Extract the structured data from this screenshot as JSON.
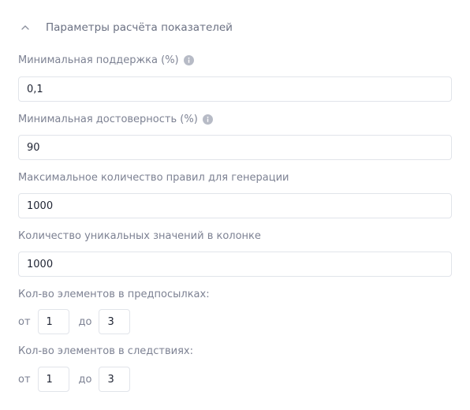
{
  "section": {
    "title": "Параметры расчёта показателей",
    "chevron_icon": "chevron-up-icon"
  },
  "fields": {
    "min_support": {
      "label": "Минимальная поддержка (%)",
      "value": "0,1",
      "info_icon": "info-icon"
    },
    "min_confidence": {
      "label": "Минимальная достоверность (%)",
      "value": "90",
      "info_icon": "info-icon"
    },
    "max_rules": {
      "label": "Максимальное количество правил для генерации",
      "value": "1000"
    },
    "unique_values": {
      "label": "Количество уникальных значений в колонке",
      "value": "1000"
    }
  },
  "ranges": {
    "antecedents": {
      "label": "Кол-во элементов в предпосылках:",
      "from_word": "от",
      "from_value": "1",
      "to_word": "до",
      "to_value": "3"
    },
    "consequents": {
      "label": "Кол-во элементов в следствиях:",
      "from_word": "от",
      "from_value": "1",
      "to_word": "до",
      "to_value": "3"
    }
  },
  "colors": {
    "label_text": "#7d8293",
    "input_border": "#e1e4ea",
    "info_icon": "#b7bbc6"
  }
}
